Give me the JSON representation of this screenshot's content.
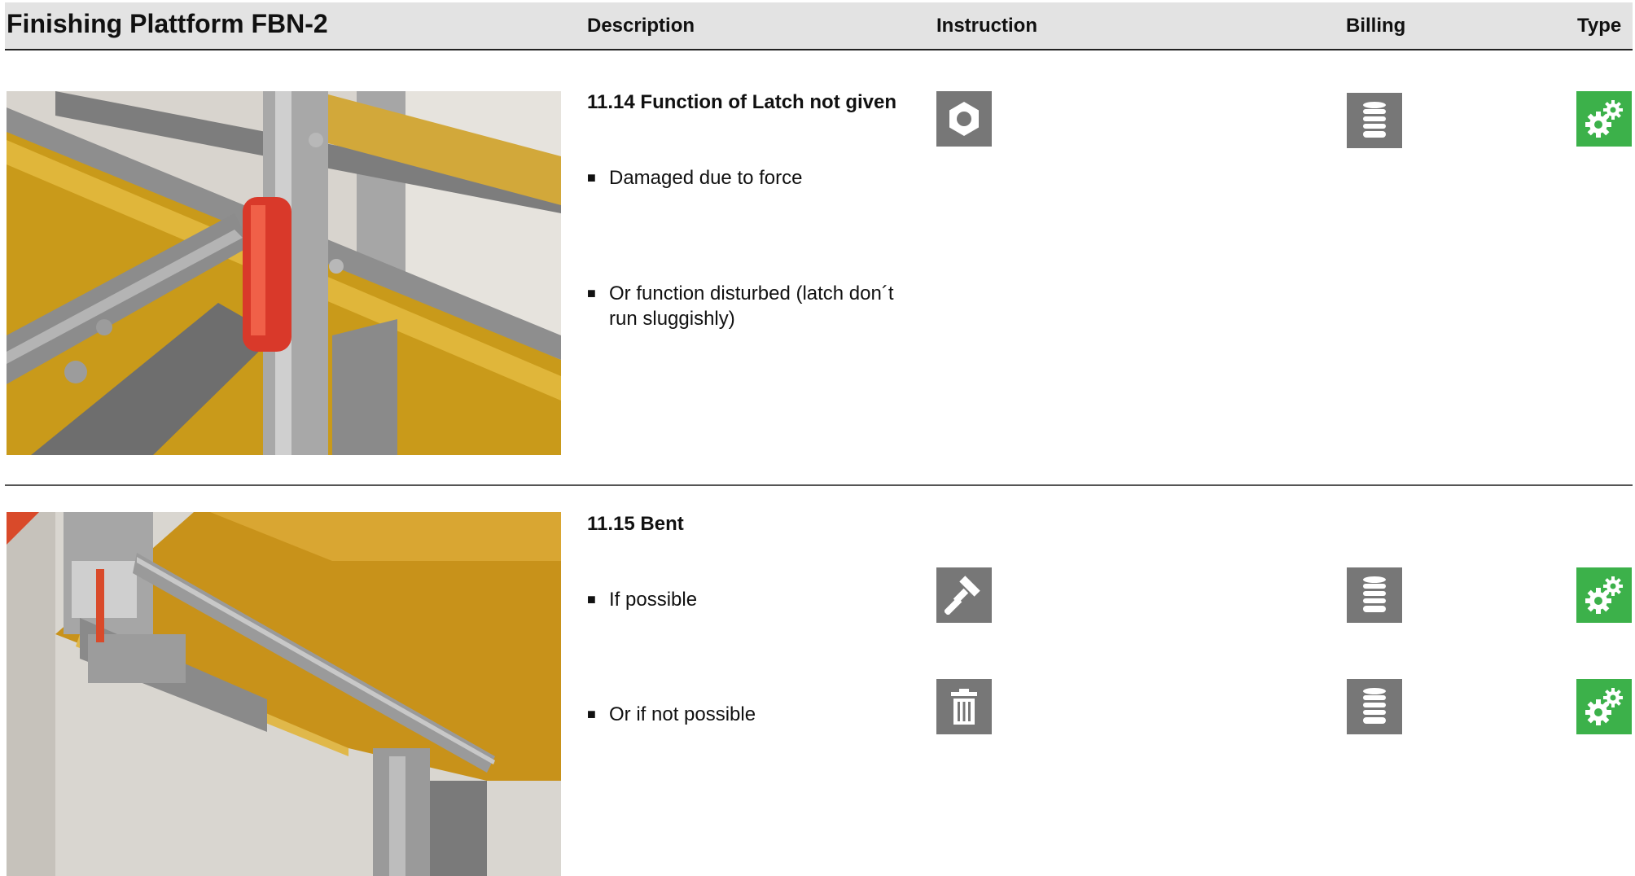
{
  "header": {
    "title": "Finishing Plattform FBN-2",
    "columns": {
      "description": "Description",
      "instruction": "Instruction",
      "billing": "Billing",
      "type": "Type"
    }
  },
  "sections": [
    {
      "title": "11.14 Function of Latch not given",
      "photo_alt": "latch-photo",
      "instruction_icon": "nut-icon",
      "billing_icon": "coin-stack-icon",
      "type_icon": "gears-icon",
      "bullets": [
        "Damaged due to force",
        "Or function disturbed (latch don´t run sluggishly)"
      ]
    },
    {
      "title": "11.15 Bent",
      "photo_alt": "bent-platform-photo",
      "bullets": [
        {
          "text": "If possible",
          "instruction_icon": "hammer-icon",
          "billing_icon": "coin-stack-icon",
          "type_icon": "gears-icon"
        },
        {
          "text": "Or if not possible",
          "instruction_icon": "trash-icon",
          "billing_icon": "coin-stack-icon",
          "type_icon": "gears-icon"
        }
      ]
    }
  ],
  "bullet_marker": "■",
  "colors": {
    "header_bg": "#e3e3e3",
    "icon_grey": "#777777",
    "icon_green": "#3cb14a"
  }
}
